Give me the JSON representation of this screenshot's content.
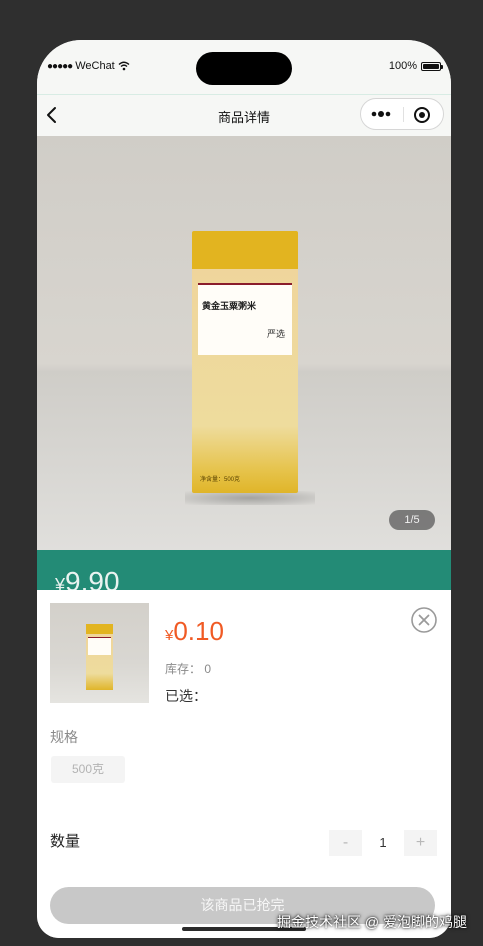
{
  "status_bar": {
    "carrier": "WeChat",
    "battery": "100%"
  },
  "nav": {
    "title": "商品详情"
  },
  "product": {
    "label_name": "黄金玉粟粥米",
    "label_brand": "严选",
    "weight_text": "净含量：500克"
  },
  "gallery": {
    "page_indicator": "1/5"
  },
  "band": {
    "currency": "¥",
    "price": "9.90"
  },
  "sku_sheet": {
    "currency": "¥",
    "price": "0.10",
    "stock": "库存： 0",
    "selected": "已选：",
    "spec_label": "规格",
    "spec_option": "500克",
    "quantity_label": "数量",
    "minus": "-",
    "quantity": "1",
    "plus": "+",
    "soldout_button": "该商品已抢完"
  },
  "watermark": "掘金技术社区 @ 爱泡脚的鸡腿",
  "colors": {
    "accent_green": "#238b76",
    "price_orange": "#f05a24",
    "disabled_gray": "#c8c8c8",
    "bag_yellow": "#e2b420"
  },
  "icons": {
    "back": "chevron-left-icon",
    "more": "more-dots-icon",
    "record": "record-icon",
    "close": "close-circle-icon"
  }
}
